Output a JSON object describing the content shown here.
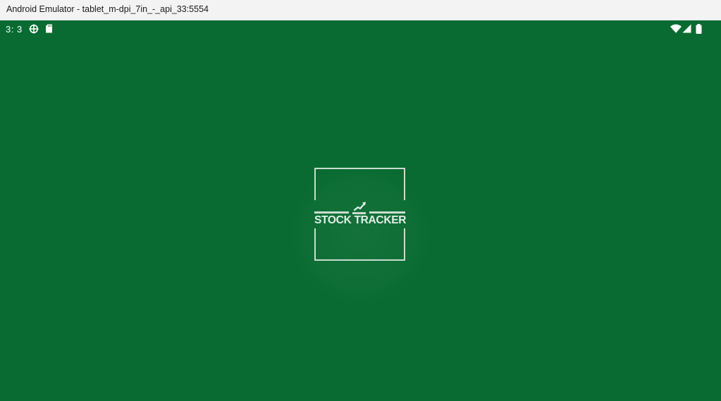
{
  "window": {
    "title": "Android Emulator - tablet_m-dpi_7in_-_api_33:5554"
  },
  "status_bar": {
    "time": "3: 3",
    "left_icons": [
      "crosshair-icon",
      "sd-card-icon"
    ],
    "right_icons": [
      "wifi-icon",
      "cell-signal-icon",
      "battery-icon"
    ]
  },
  "splash": {
    "logo_text": "STOCK TRACKER",
    "logo_icon": "trend-up-icon",
    "background_color": "#096b31",
    "logo_color": "#c9dcce"
  }
}
